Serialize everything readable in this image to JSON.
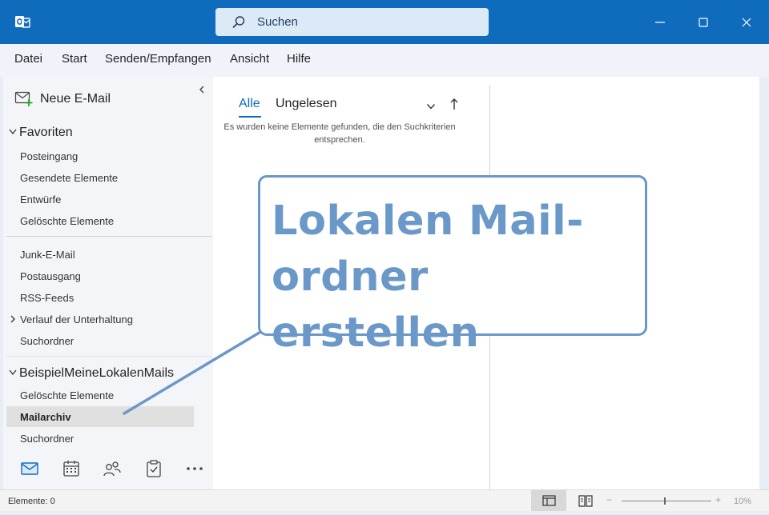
{
  "search": {
    "placeholder": "Suchen"
  },
  "menu": [
    "Datei",
    "Start",
    "Senden/Empfangen",
    "Ansicht",
    "Hilfe"
  ],
  "new_mail": "Neue E-Mail",
  "favorites": {
    "header": "Favoriten",
    "items": [
      "Posteingang",
      "Gesendete Elemente",
      "Entwürfe",
      "Gelöschte Elemente"
    ]
  },
  "mailbox_folders": [
    "Junk-E-Mail",
    "Postausgang",
    "RSS-Feeds",
    "Verlauf der Unterhaltung",
    "Suchordner"
  ],
  "local_store": {
    "header": "BeispielMeineLokalenMails",
    "items": [
      "Gelöschte Elemente",
      "Mailarchiv",
      "Suchordner"
    ]
  },
  "list": {
    "tab_all": "Alle",
    "tab_unread": "Ungelesen",
    "empty_message": "Es wurden keine Elemente gefunden, die den Suchkriterien entsprechen."
  },
  "callout": {
    "line1": "Lokalen Mail-",
    "line2": "ordner erstellen"
  },
  "status": {
    "items": "Elemente: 0",
    "zoom": "10%",
    "zoom_minus": "−",
    "zoom_plus": "+"
  },
  "colors": {
    "accent": "#0f6cbd",
    "callout": "#6a98c8"
  },
  "icons": {
    "app": "outlook-logo-icon",
    "search": "search-icon",
    "nav": [
      "mail-icon",
      "calendar-icon",
      "people-icon",
      "tasks-icon",
      "more-icon"
    ]
  }
}
